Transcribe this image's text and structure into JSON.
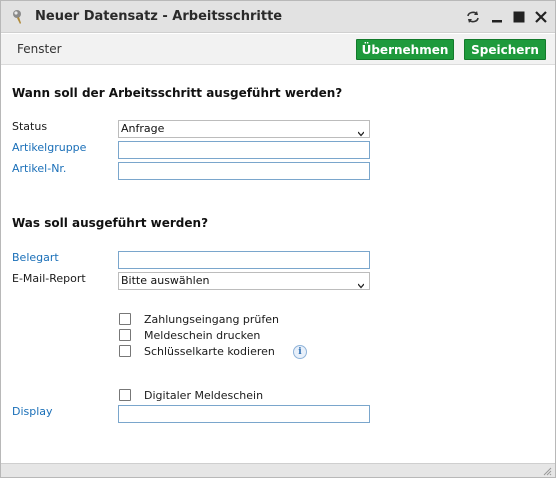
{
  "window": {
    "title": "Neuer Datensatz - Arbeitsschritte"
  },
  "toolbar": {
    "menu_label": "Fenster",
    "apply_label": "Übernehmen",
    "save_label": "Speichern"
  },
  "section_when": {
    "title": "Wann soll der Arbeitsschritt ausgeführt werden?",
    "status_label": "Status",
    "status_value": "Anfrage",
    "artikelgruppe_label": "Artikelgruppe",
    "artikelgruppe_value": "",
    "artikelnr_label": "Artikel-Nr.",
    "artikelnr_value": ""
  },
  "section_what": {
    "title": "Was soll ausgeführt werden?",
    "belegart_label": "Belegart",
    "belegart_value": "",
    "email_report_label": "E-Mail-Report",
    "email_report_value": "Bitte auswählen",
    "checkboxes": [
      {
        "label": "Zahlungseingang prüfen",
        "checked": false
      },
      {
        "label": "Meldeschein drucken",
        "checked": false
      },
      {
        "label": "Schlüsselkarte kodieren",
        "checked": false
      }
    ],
    "digital_checkbox": {
      "label": "Digitaler Meldeschein",
      "checked": false
    },
    "display_label": "Display",
    "display_value": ""
  },
  "colors": {
    "accent_green": "#1e9a3c",
    "link_blue": "#1a6fb8",
    "field_border": "#7aa6cc"
  },
  "icons": {
    "app": "app-pin-icon",
    "restore": "restore-arrows-icon",
    "minimize": "minimize-icon",
    "maximize": "maximize-icon",
    "close": "close-icon",
    "info": "info-icon",
    "caret": "chevron-down-icon",
    "resize": "resize-grip-icon"
  }
}
